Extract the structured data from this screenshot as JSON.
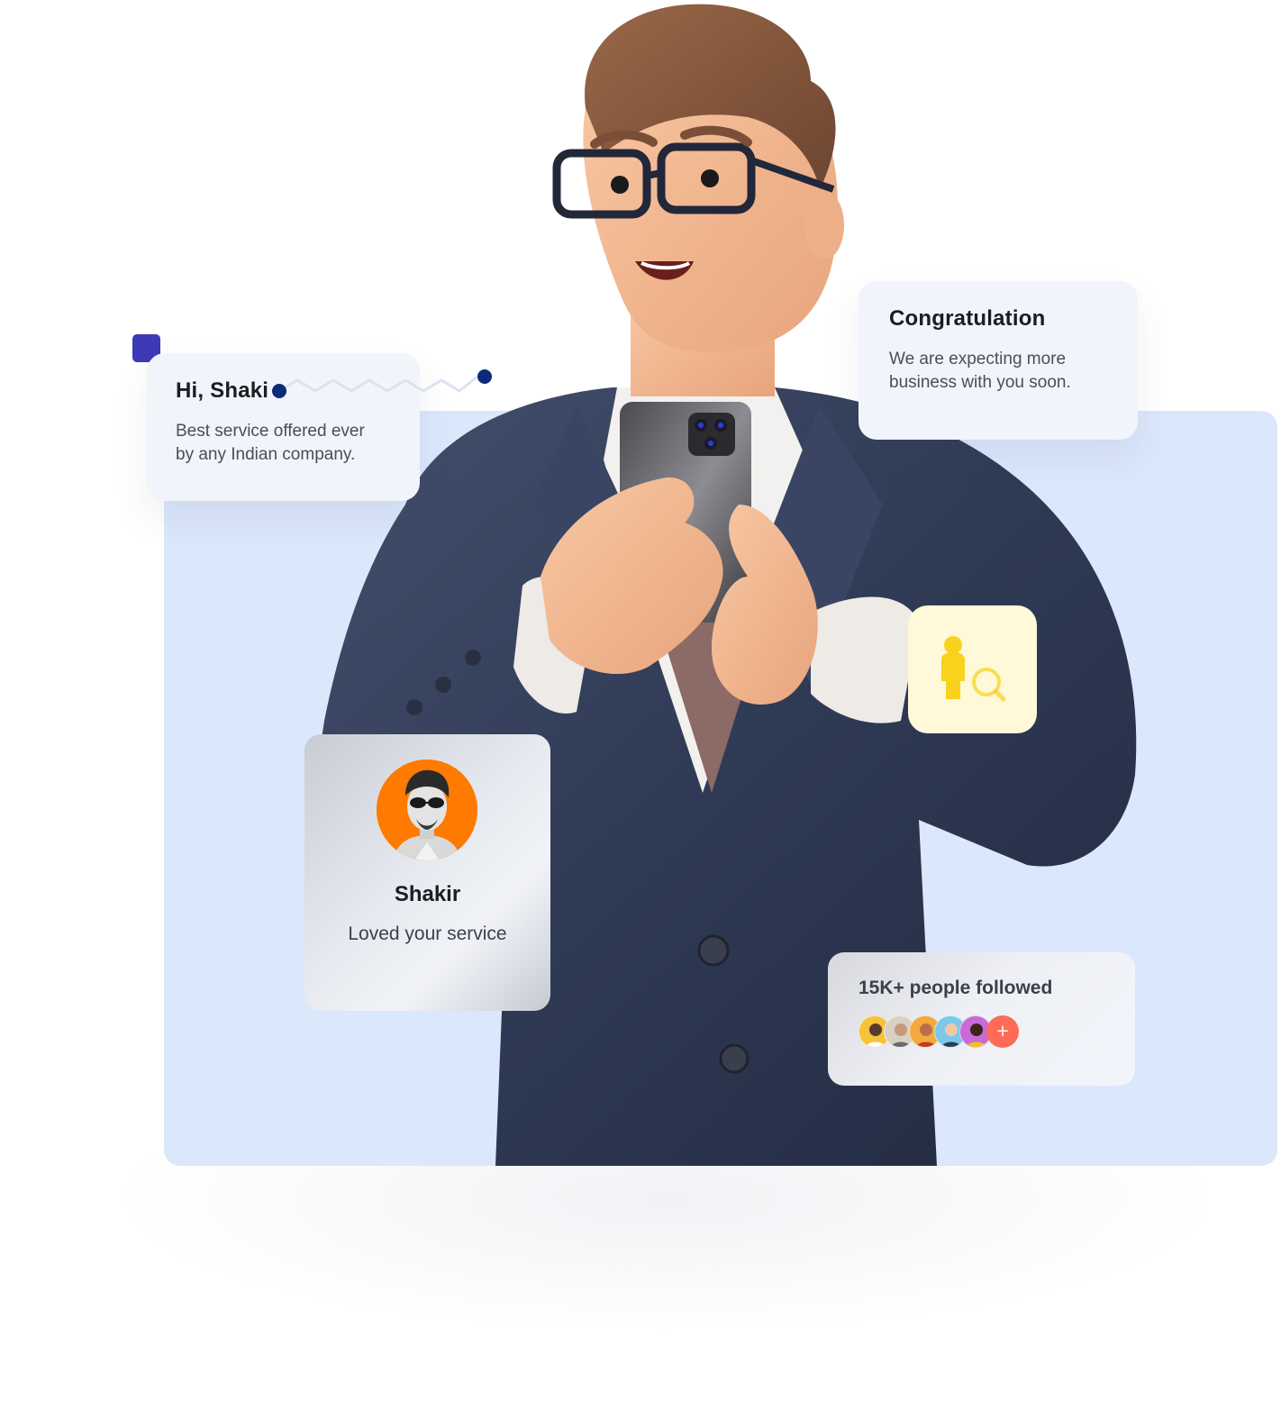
{
  "greeting_card": {
    "title": "Hi, Shaki",
    "text_line1": "Best service offered ever",
    "text_line2": "by any Indian company."
  },
  "congrats_card": {
    "title": "Congratulation",
    "text_line1": "We are expecting more",
    "text_line2": "business with you soon."
  },
  "profile_card": {
    "name": "Shakir",
    "text": "Loved your service",
    "avatar_bg": "#ff7a00"
  },
  "search_card": {
    "icon": "person-search-icon",
    "bg": "#fff8d9",
    "icon_color": "#f8d21c"
  },
  "followers_card": {
    "title": "15K+ people followed",
    "plus_label": "+",
    "avatars": [
      "avatar-1",
      "avatar-2",
      "avatar-3",
      "avatar-4",
      "avatar-5"
    ]
  },
  "colors": {
    "panel_bg": "#dbe7fb",
    "accent_square": "#3d3ab7",
    "zigzag_line": "#dbe3f2",
    "zigzag_dots": "#0d2a7a",
    "suit": "#2e3852",
    "skin": "#f1b58c",
    "hair": "#8a5a3e"
  }
}
